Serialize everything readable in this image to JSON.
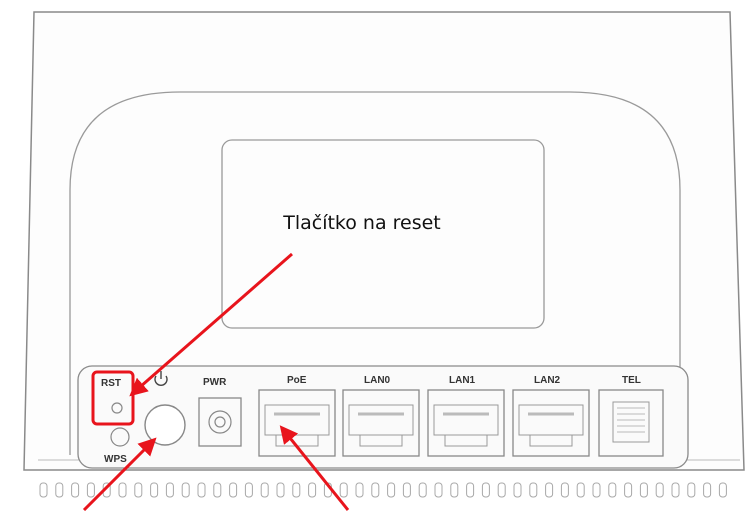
{
  "annotation": {
    "reset_label": "Tlačítko na reset"
  },
  "ports": {
    "rst": "RST",
    "wps": "WPS",
    "pwr": "PWR",
    "poe": "PoE",
    "lan0": "LAN0",
    "lan1": "LAN1",
    "lan2": "LAN2",
    "tel": "TEL"
  },
  "colors": {
    "arrow": "#e8141c",
    "highlight": "#e8141c",
    "outline": "#8a8a8a"
  }
}
